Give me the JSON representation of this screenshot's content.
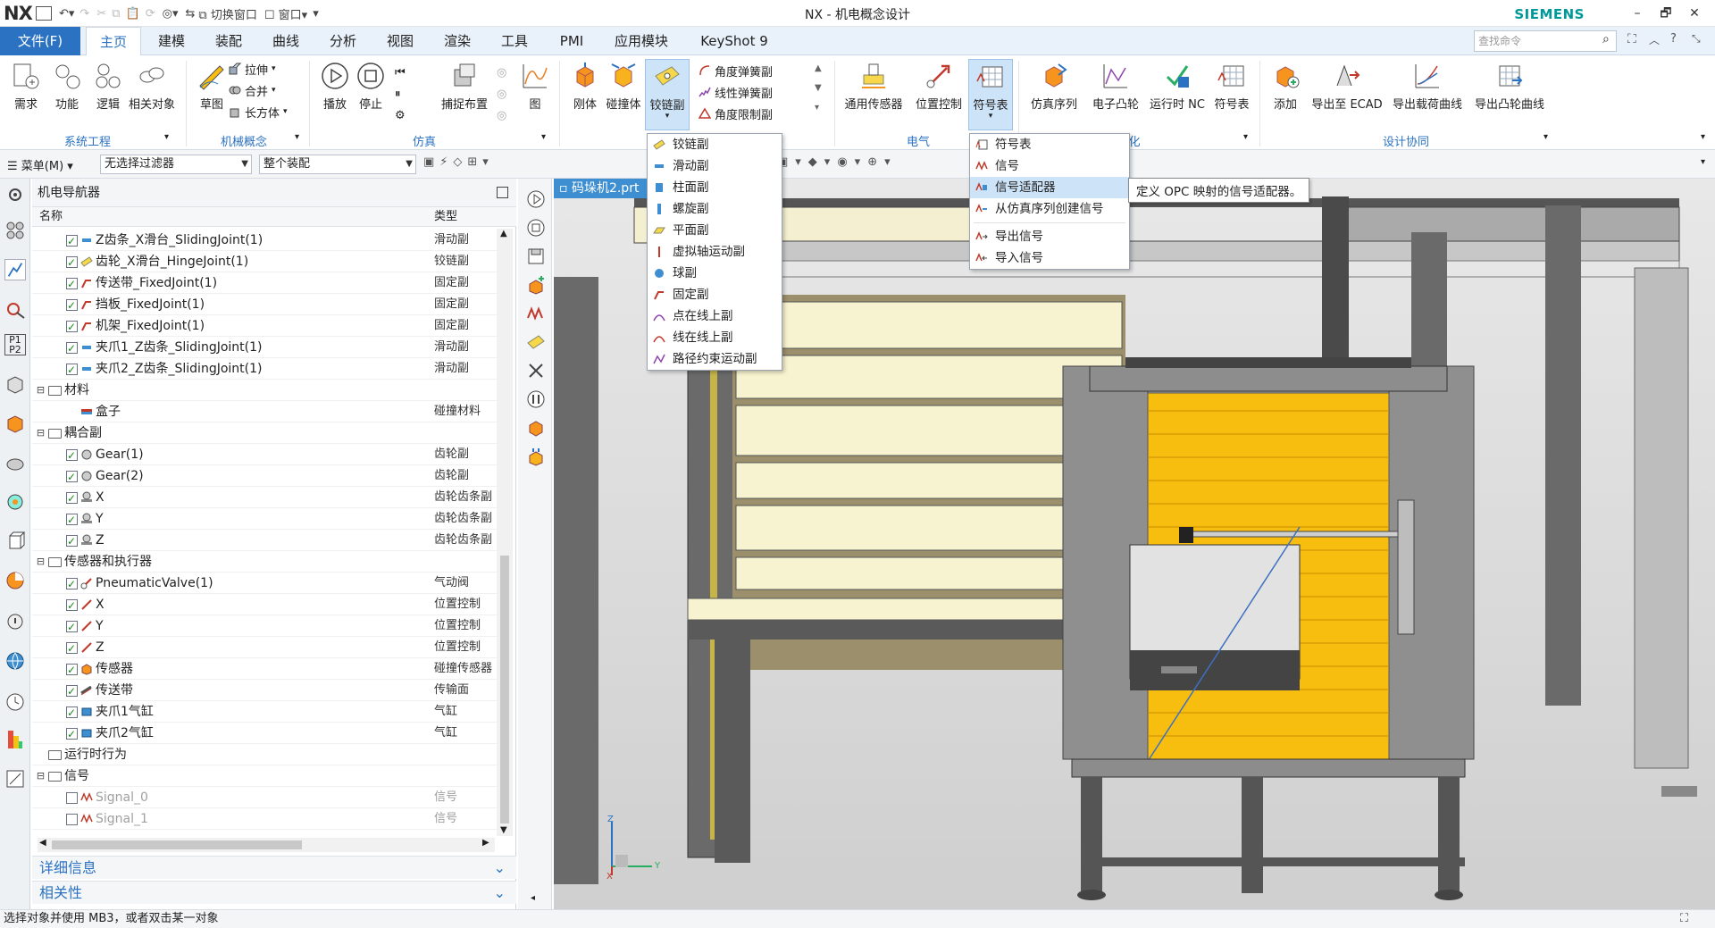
{
  "titlebar": {
    "logo": "NX",
    "switch_window": "切换窗口",
    "window_menu": "窗口",
    "title": "NX - 机电概念设计",
    "brand": "SIEMENS",
    "min": "–",
    "restore": "🗗",
    "close": "✕"
  },
  "menubar": {
    "file": "文件(F)",
    "tabs": [
      "主页",
      "建模",
      "装配",
      "曲线",
      "分析",
      "视图",
      "渲染",
      "工具",
      "PMI",
      "应用模块",
      "KeyShot 9"
    ],
    "search_placeholder": "查找命令"
  },
  "ribbon": {
    "system_engineering": {
      "label": "系统工程",
      "buttons": [
        "需求",
        "功能",
        "逻辑",
        "相关对象"
      ]
    },
    "mech_concept": {
      "label": "机械概念",
      "buttons": [
        "草图"
      ],
      "small": [
        "拉伸",
        "合并",
        "长方体"
      ]
    },
    "simulation": {
      "label": "仿真",
      "buttons": [
        "播放",
        "停止",
        "捕捉布置",
        "图"
      ]
    },
    "mechanical": {
      "buttons": [
        "刚体",
        "碰撞体",
        "铰链副"
      ],
      "small": [
        "角度弹簧副",
        "线性弹簧副",
        "角度限制副"
      ]
    },
    "electrical": {
      "label": "电气",
      "buttons": [
        "通用传感器",
        "位置控制",
        "符号表"
      ]
    },
    "automation": {
      "label": "化",
      "buttons": [
        "仿真序列",
        "电子凸轮",
        "运行时 NC",
        "符号表"
      ]
    },
    "design_collab": {
      "label": "设计协同",
      "buttons": [
        "添加",
        "导出至 ECAD",
        "导出载荷曲线",
        "导出凸轮曲线"
      ]
    }
  },
  "filterbar": {
    "menu": "菜单(M)",
    "filter": "无选择过滤器",
    "scope": "整个装配"
  },
  "navigator": {
    "title": "机电导航器",
    "col_name": "名称",
    "col_type": "类型",
    "rows": [
      {
        "name": "Z齿条_X滑台_SlidingJoint(1)",
        "type": "滑动副"
      },
      {
        "name": "齿轮_X滑台_HingeJoint(1)",
        "type": "铰链副"
      },
      {
        "name": "传送带_FixedJoint(1)",
        "type": "固定副"
      },
      {
        "name": "挡板_FixedJoint(1)",
        "type": "固定副"
      },
      {
        "name": "机架_FixedJoint(1)",
        "type": "固定副"
      },
      {
        "name": "夹爪1_Z齿条_SlidingJoint(1)",
        "type": "滑动副"
      },
      {
        "name": "夹爪2_Z齿条_SlidingJoint(1)",
        "type": "滑动副"
      },
      {
        "name": "材料",
        "type": ""
      },
      {
        "name": "盒子",
        "type": "碰撞材料"
      },
      {
        "name": "耦合副",
        "type": ""
      },
      {
        "name": "Gear(1)",
        "type": "齿轮副"
      },
      {
        "name": "Gear(2)",
        "type": "齿轮副"
      },
      {
        "name": "X",
        "type": "齿轮齿条副"
      },
      {
        "name": "Y",
        "type": "齿轮齿条副"
      },
      {
        "name": "Z",
        "type": "齿轮齿条副"
      },
      {
        "name": "传感器和执行器",
        "type": ""
      },
      {
        "name": "PneumaticValve(1)",
        "type": "气动阀"
      },
      {
        "name": "X",
        "type": "位置控制"
      },
      {
        "name": "Y",
        "type": "位置控制"
      },
      {
        "name": "Z",
        "type": "位置控制"
      },
      {
        "name": "传感器",
        "type": "碰撞传感器"
      },
      {
        "name": "传送带",
        "type": "传输面"
      },
      {
        "name": "夹爪1气缸",
        "type": "气缸"
      },
      {
        "name": "夹爪2气缸",
        "type": "气缸"
      },
      {
        "name": "运行时行为",
        "type": ""
      },
      {
        "name": "信号",
        "type": ""
      },
      {
        "name": "Signal_0",
        "type": "信号"
      },
      {
        "name": "Signal_1",
        "type": "信号"
      }
    ],
    "details": "详细信息",
    "dependencies": "相关性"
  },
  "document_tab": "码垛机2.prt",
  "joint_menu": [
    "铰链副",
    "滑动副",
    "柱面副",
    "螺旋副",
    "平面副",
    "虚拟轴运动副",
    "球副",
    "固定副",
    "点在线上副",
    "线在线上副",
    "路径约束运动副"
  ],
  "signal_menu": [
    "符号表",
    "信号",
    "信号适配器",
    "从仿真序列创建信号",
    "导出信号",
    "导入信号"
  ],
  "tooltip": "定义 OPC 映射的信号适配器。",
  "statusbar": "选择对象并使用 MB3，或者双击某一对象",
  "triad": {
    "x": "X",
    "y": "Y",
    "z": "Z"
  },
  "colors": {
    "accent": "#2b73c2",
    "brand": "#009999",
    "highlight": "#cde3f7",
    "gripper_yellow": "#f7be10"
  }
}
